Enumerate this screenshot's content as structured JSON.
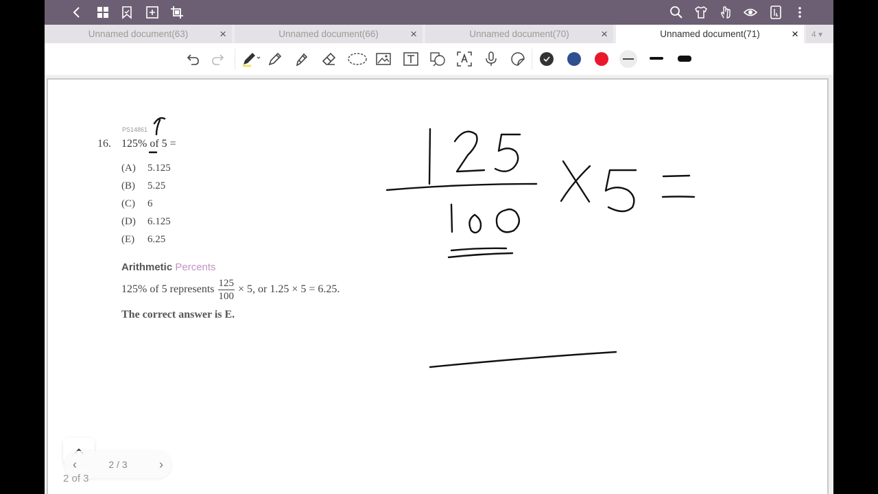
{
  "tabs": [
    {
      "label": "Unnamed document(63)",
      "close": "×"
    },
    {
      "label": "Unnamed document(66)",
      "close": "×"
    },
    {
      "label": "Unnamed document(70)",
      "close": "×"
    },
    {
      "label": "Unnamed document(71)",
      "close": "×"
    }
  ],
  "tab_more": "4 ▾",
  "colors": {
    "topbar": "#6c5f73",
    "swatches": [
      "#333333",
      "#2f4f8f",
      "#e8192c",
      "#bbbbbb"
    ]
  },
  "document": {
    "question_code": "PS14861",
    "question_number": "16.",
    "question_text": "125% of 5 =",
    "options": [
      {
        "letter": "(A)",
        "value": "5.125"
      },
      {
        "letter": "(B)",
        "value": "5.25"
      },
      {
        "letter": "(C)",
        "value": "6"
      },
      {
        "letter": "(D)",
        "value": "6.125"
      },
      {
        "letter": "(E)",
        "value": "6.25"
      }
    ],
    "solution_heading": "Arithmetic",
    "solution_tag": "Percents",
    "solution_prefix": "125% of 5 represents",
    "fraction_num": "125",
    "fraction_den": "100",
    "solution_suffix": "× 5, or 1.25 × 5 = 6.25.",
    "answer": "The correct answer is E."
  },
  "pager": {
    "label": "2 / 3",
    "prev": "‹",
    "next": "›"
  },
  "page_count": "2 of 3"
}
